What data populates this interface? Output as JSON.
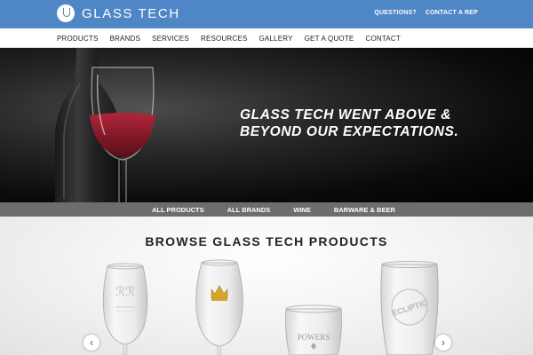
{
  "header": {
    "brand": "GLASS TECH",
    "links": [
      "QUESTIONS?",
      "CONTACT A REP"
    ]
  },
  "nav": {
    "items": [
      "PRODUCTS",
      "BRANDS",
      "SERVICES",
      "RESOURCES",
      "GALLERY",
      "GET A QUOTE",
      "CONTACT"
    ]
  },
  "hero": {
    "headline_line1": "GLASS TECH WENT ABOVE &",
    "headline_line2": "BEYOND OUR EXPECTATIONS."
  },
  "categories": {
    "items": [
      "ALL PRODUCTS",
      "ALL BRANDS",
      "WINE",
      "BARWARE & BEER"
    ]
  },
  "browse": {
    "title": "BROWSE GLASS TECH PRODUCTS",
    "products": [
      {
        "engraving": ""
      },
      {
        "engraving": ""
      },
      {
        "engraving": "POWERS"
      },
      {
        "engraving": "ECLIPTIC"
      }
    ],
    "arrow_left": "‹",
    "arrow_right": "›"
  },
  "colors": {
    "header_bg": "#4f86c6",
    "category_bar_bg": "#6d6d6d",
    "crown_gold": "#d4a62a"
  }
}
